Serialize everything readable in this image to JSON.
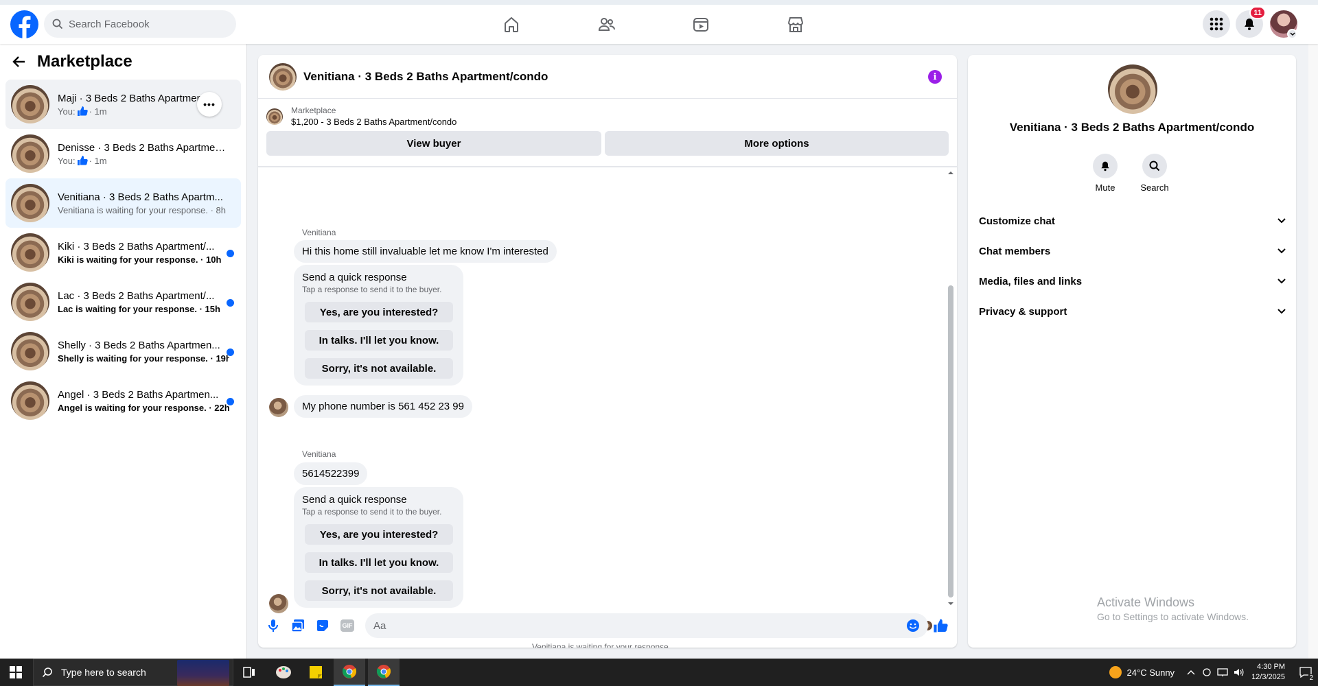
{
  "topbar": {
    "search_placeholder": "Search Facebook",
    "notification_count": "11",
    "brand_color": "#0866ff"
  },
  "sidebar": {
    "title": "Marketplace",
    "conversations": [
      {
        "title": "Maji · 3 Beds 2 Baths Apartmen...",
        "sub_prefix": "You:",
        "sub_time": "· 1m",
        "unread": false,
        "liked": true
      },
      {
        "title": "Denisse · 3 Beds 2 Baths Apartmen...",
        "sub_prefix": "You:",
        "sub_time": "· 1m",
        "unread": false,
        "liked": true
      },
      {
        "title": "Venitiana · 3 Beds 2 Baths Apartm...",
        "sub": "Venitiana is waiting for your response. · 8h",
        "unread": false
      },
      {
        "title": "Kiki · 3 Beds 2 Baths Apartment/...",
        "sub": "Kiki is waiting for your response. · 10h",
        "unread": true
      },
      {
        "title": "Lac · 3 Beds 2 Baths Apartment/...",
        "sub": "Lac is waiting for your response. · 15h",
        "unread": true
      },
      {
        "title": "Shelly · 3 Beds 2 Baths Apartmen...",
        "sub": "Shelly is waiting for your response. · 19h",
        "unread": true
      },
      {
        "title": "Angel · 3 Beds 2 Baths Apartmen...",
        "sub": "Angel is waiting for your response. · 22h",
        "unread": true
      }
    ]
  },
  "chat": {
    "title": "Venitiana · 3 Beds 2 Baths Apartment/condo",
    "listing_label": "Marketplace",
    "listing_price": "$1,200 - 3 Beds 2 Baths Apartment/condo",
    "view_buyer": "View buyer",
    "more_options": "More options",
    "sender_name": "Venitiana",
    "msg1": "Hi this home still invaluable  let me know I'm interested",
    "msg2": "My phone number is 561 452 23 99",
    "msg3": "5614522399",
    "quick_title": "Send a quick response",
    "quick_sub": "Tap a response to send it to the buyer.",
    "quick_options": [
      "Yes, are you interested?",
      "In talks. I'll let you know.",
      "Sorry, it's not available."
    ],
    "waiting": "Venitiana is waiting for your response.",
    "input_placeholder": "Aa",
    "gif_label": "GIF"
  },
  "details": {
    "title": "Venitiana · 3 Beds 2 Baths Apartment/condo",
    "mute": "Mute",
    "search": "Search",
    "sections": [
      "Customize chat",
      "Chat members",
      "Media, files and links",
      "Privacy & support"
    ]
  },
  "watermark": {
    "line1": "Activate Windows",
    "line2": "Go to Settings to activate Windows."
  },
  "taskbar": {
    "search_text": "Type here to search",
    "weather": "24°C  Sunny",
    "time": "4:30 PM",
    "date": "12/3/2025",
    "notif_count": "2"
  }
}
